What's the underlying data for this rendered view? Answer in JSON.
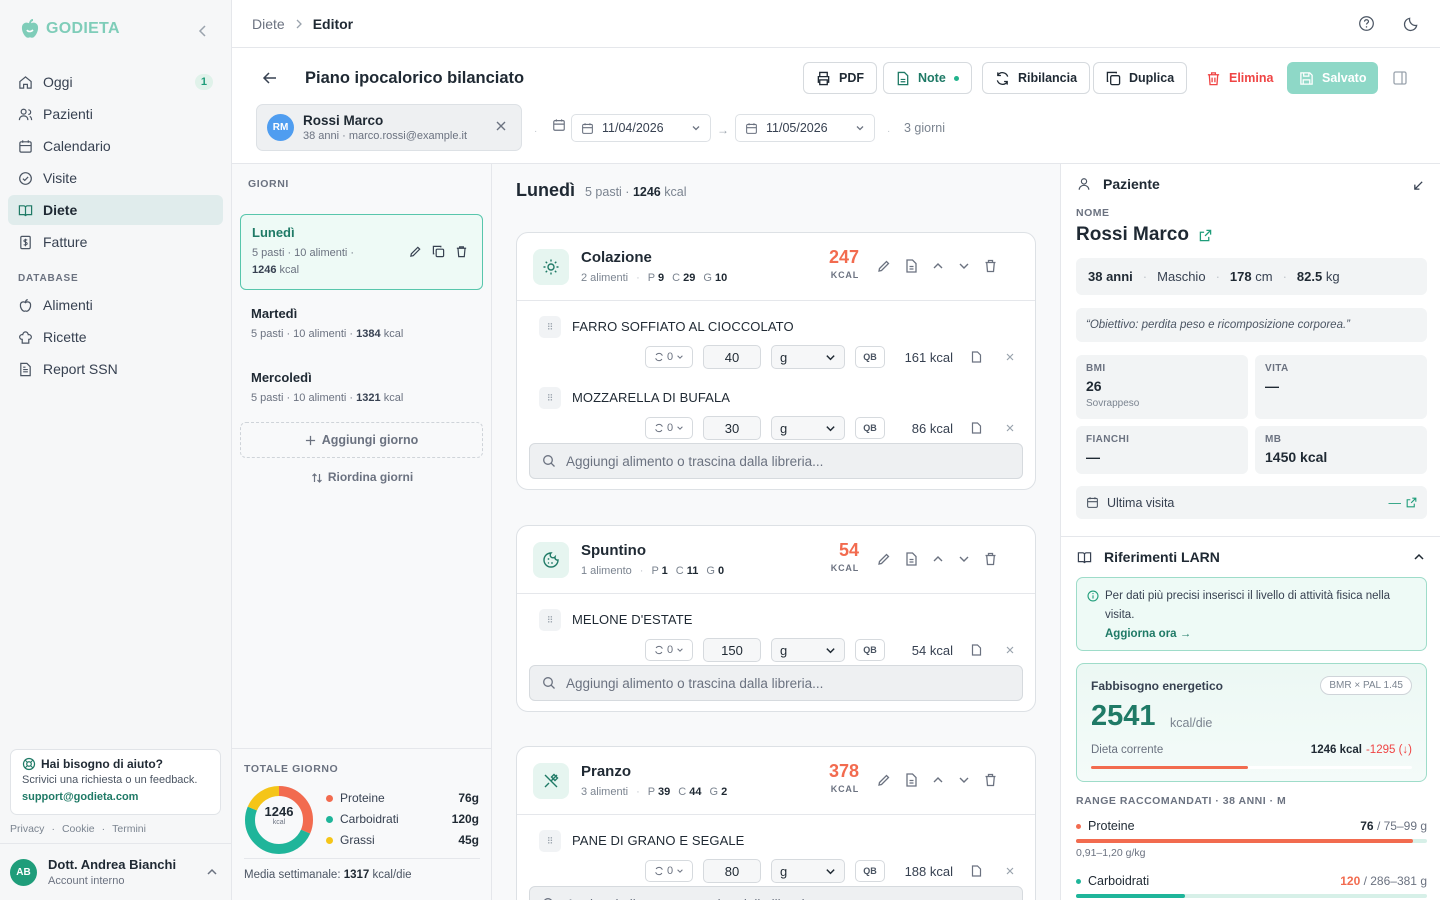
{
  "app": {
    "name": "GODIETA"
  },
  "breadcrumb": {
    "parent": "Diete",
    "current": "Editor"
  },
  "sidebar": {
    "items": [
      {
        "label": "Oggi",
        "icon": "home-icon",
        "badge": "1"
      },
      {
        "label": "Pazienti",
        "icon": "users-icon"
      },
      {
        "label": "Calendario",
        "icon": "calendar-icon"
      },
      {
        "label": "Visite",
        "icon": "check-circle-icon"
      },
      {
        "label": "Diete",
        "icon": "book-icon",
        "active": true
      },
      {
        "label": "Fatture",
        "icon": "receipt-icon"
      }
    ],
    "database_heading": "DATABASE",
    "db_items": [
      {
        "label": "Alimenti",
        "icon": "apple-icon"
      },
      {
        "label": "Ricette",
        "icon": "chef-hat-icon"
      },
      {
        "label": "Report SSN",
        "icon": "file-text-icon"
      }
    ],
    "help": {
      "title": "Hai bisogno di aiuto?",
      "desc": "Scrivici una richiesta o un feedback.",
      "email": "support@godieta.com"
    },
    "legal": [
      "Privacy",
      "·",
      "Cookie",
      "·",
      "Termini"
    ],
    "user": {
      "initials": "AB",
      "name": "Dott. Andrea Bianchi",
      "role": "Account interno"
    }
  },
  "header": {
    "title": "Piano ipocalorico bilanciato",
    "buttons": {
      "pdf": "PDF",
      "note": "Note",
      "rebalance": "Ribilancia",
      "duplicate": "Duplica",
      "delete": "Elimina",
      "save": "Salvato"
    },
    "patient": {
      "initials": "RM",
      "name": "Rossi Marco",
      "sub": "38 anni · marco.rossi@example.it"
    },
    "start_date": "11/04/2026",
    "end_date": "11/05/2026",
    "arrow": "→",
    "dot": "·",
    "duration": "3 giorni"
  },
  "days": {
    "heading": "GIORNI",
    "list": [
      {
        "name": "Lunedì",
        "meta": "5 pasti · 10 alimenti ·",
        "kcal": "1246",
        "unit": "kcal"
      },
      {
        "name": "Martedì",
        "meta": "5 pasti · 10 alimenti ·",
        "kcal": "1384",
        "unit": "kcal"
      },
      {
        "name": "Mercoledì",
        "meta": "5 pasti · 10 alimenti ·",
        "kcal": "1321",
        "unit": "kcal"
      }
    ],
    "add": "Aggiungi giorno",
    "reorder": "Riordina giorni",
    "totals": {
      "heading": "TOTALE GIORNO",
      "kcal": "1246",
      "unit": "kcal",
      "macros": [
        {
          "label": "Proteine",
          "value": "76g",
          "color": "#f26b4f"
        },
        {
          "label": "Carboidrati",
          "value": "120g",
          "color": "#1fb59a"
        },
        {
          "label": "Grassi",
          "value": "45g",
          "color": "#f5c518"
        }
      ],
      "weekly_label": "Media settimanale:",
      "weekly_value": "1317",
      "weekly_unit": "kcal/die"
    }
  },
  "editor": {
    "day": "Lunedì",
    "summary": "5 pasti ·",
    "kcal": "1246",
    "kcal_unit": "kcal",
    "add_placeholder": "Aggiungi alimento o trascina dalla libreria...",
    "meals": [
      {
        "name": "Colazione",
        "count": "2 alimenti",
        "p": "9",
        "c": "29",
        "g": "10",
        "kcal": "247",
        "icon": "sun-icon",
        "foods": [
          {
            "name": "FARRO SOFFIATO AL CIOCCOLATO",
            "sub": "0",
            "qty": "40",
            "unit": "g",
            "qb": "QB",
            "kcal": "161 kcal"
          },
          {
            "name": "MOZZARELLA DI BUFALA",
            "sub": "0",
            "qty": "30",
            "unit": "g",
            "qb": "QB",
            "kcal": "86 kcal"
          }
        ]
      },
      {
        "name": "Spuntino",
        "count": "1 alimento",
        "p": "1",
        "c": "11",
        "g": "0",
        "kcal": "54",
        "icon": "cookie-icon",
        "foods": [
          {
            "name": "MELONE D'ESTATE",
            "sub": "0",
            "qty": "150",
            "unit": "g",
            "qb": "QB",
            "kcal": "54 kcal"
          }
        ]
      },
      {
        "name": "Pranzo",
        "count": "3 alimenti",
        "p": "39",
        "c": "44",
        "g": "2",
        "kcal": "378",
        "icon": "utensils-icon",
        "foods": [
          {
            "name": "PANE DI GRANO E SEGALE",
            "sub": "0",
            "qty": "80",
            "unit": "g",
            "qb": "QB",
            "kcal": "188 kcal"
          }
        ]
      }
    ],
    "macro_letters": {
      "p": "P",
      "c": "C",
      "g": "G"
    },
    "kcal_caption": "KCAL"
  },
  "panel": {
    "patient_heading": "Paziente",
    "name_label": "NOME",
    "name": "Rossi Marco",
    "age": "38 anni",
    "sex": "Maschio",
    "height": "178",
    "height_unit": "cm",
    "weight": "82.5",
    "weight_unit": "kg",
    "goal": "“Obiettivo: perdita peso e ricomposizione corporea.”",
    "stats": [
      {
        "label": "BMI",
        "value": "26",
        "sub": "Sovrappeso"
      },
      {
        "label": "VITA",
        "value": "—",
        "sub": ""
      },
      {
        "label": "FIANCHI",
        "value": "—",
        "sub": ""
      },
      {
        "label": "MB",
        "value": "1450 kcal",
        "sub": ""
      }
    ],
    "last_visit": "Ultima visita",
    "last_visit_value": "—",
    "larn_heading": "Riferimenti LARN",
    "info": "Per dati più precisi inserisci il livello di attività fisica nella visita.",
    "info_link": "Aggiorna ora →",
    "energy": {
      "title": "Fabbisogno energetico",
      "pill": "BMR × PAL 1.45",
      "value": "2541",
      "unit": "kcal/die",
      "diet_label": "Dieta corrente",
      "diet_value": "1246 kcal",
      "diff": "-1295 (↓)",
      "ratio": 0.49
    },
    "range_heading": "RANGE RACCOMANDATI · 38 ANNI · M",
    "ranges": [
      {
        "label": "Proteine",
        "value": "76",
        "range": "/ 75–99 g",
        "sub": "0,91–1,20 g/kg",
        "color": "#f26b4f",
        "ratio": 0.96
      },
      {
        "label": "Carboidrati",
        "value": "120",
        "range": "/ 286–381 g",
        "sub": "",
        "color": "#1fb59a",
        "ratio": 0.31
      }
    ]
  }
}
